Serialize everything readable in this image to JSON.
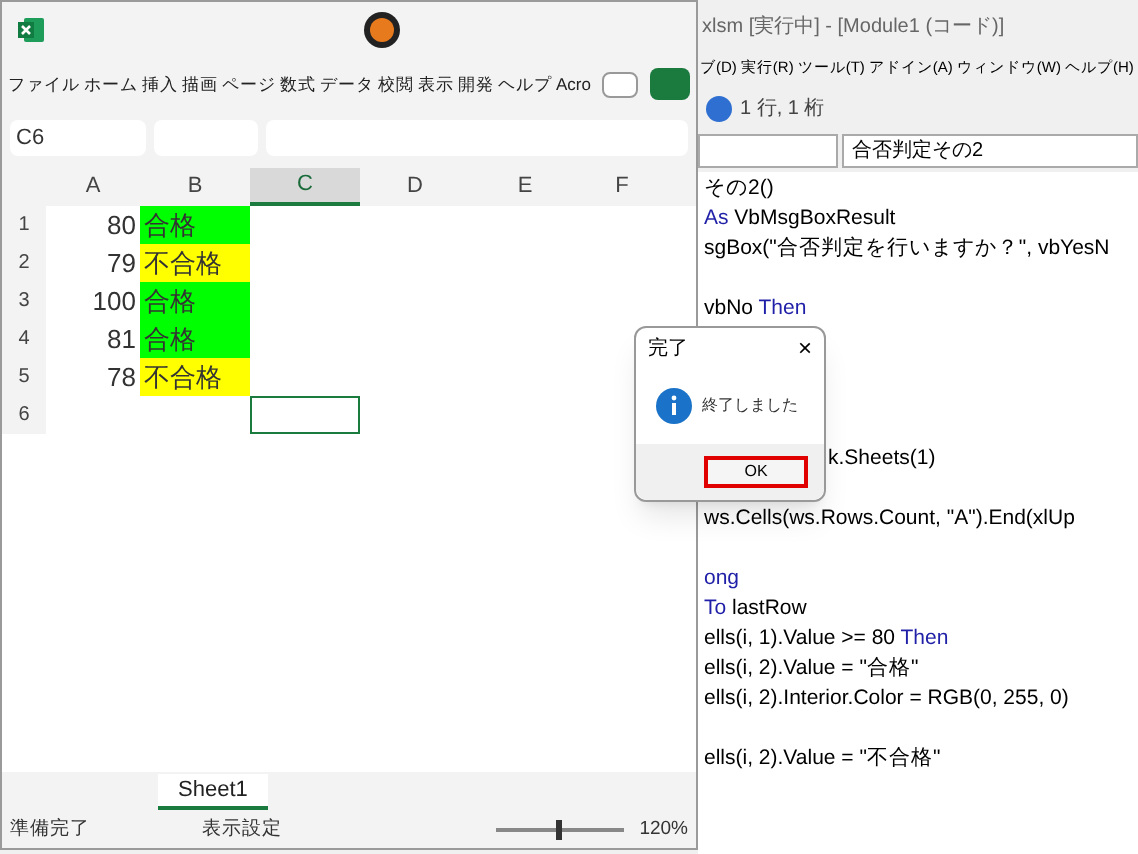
{
  "excel": {
    "ribbon_tabs": [
      {
        "label": "ファイル"
      },
      {
        "label": "ホーム"
      },
      {
        "label": "挿入"
      },
      {
        "label": "描画"
      },
      {
        "label": "ページ"
      },
      {
        "label": "数式"
      },
      {
        "label": "データ"
      },
      {
        "label": "校閲"
      },
      {
        "label": "表示"
      },
      {
        "label": "開発"
      },
      {
        "label": "ヘルプ"
      },
      {
        "label": "Acro"
      }
    ],
    "name_box": "C6",
    "columns": [
      "A",
      "B",
      "C",
      "D",
      "E",
      "F"
    ],
    "rows": [
      {
        "number": "1",
        "a": "80",
        "b": "合格",
        "color": "#00ff00"
      },
      {
        "number": "2",
        "a": "79",
        "b": "不合格",
        "color": "#ffff00"
      },
      {
        "number": "3",
        "a": "100",
        "b": "合格",
        "color": "#00ff00"
      },
      {
        "number": "4",
        "a": "81",
        "b": "合格",
        "color": "#00ff00"
      },
      {
        "number": "5",
        "a": "78",
        "b": "不合格",
        "color": "#ffff00"
      },
      {
        "number": "6"
      }
    ],
    "sheet_tabs": [
      {
        "label": "Sheet1",
        "selected": true
      }
    ],
    "status_bar": {
      "ready": "準備完了",
      "display_settings": "表示設定",
      "zoom": "120%",
      "zoom_slider": {
        "level": 0.5
      }
    }
  },
  "vbe": {
    "title": "xlsm [実行中] - [Module1 (コード)]",
    "menu": [
      "ブ(D)",
      "実行(R)",
      "ツール(T)",
      "アドイン(A)",
      "ウィンドウ(W)",
      "ヘルプ(H)"
    ],
    "position": "1 行, 1 桁",
    "procedure": "合否判定その2",
    "code_lines": [
      {
        "kind": "code",
        "segments": [
          {
            "text": "その2()",
            "keyword": false
          }
        ]
      },
      {
        "kind": "code",
        "segments": [
          {
            "text": "As",
            "keyword": true
          },
          {
            "text": " VbMsgBoxResult",
            "keyword": false
          }
        ]
      },
      {
        "kind": "code",
        "segments": [
          {
            "text": "sgBox(\"合否判定を行いますか？\", vbYesN",
            "keyword": false
          }
        ]
      },
      {
        "kind": "empty"
      },
      {
        "kind": "code",
        "segments": [
          {
            "text": "vbNo ",
            "keyword": false
          },
          {
            "text": "Then",
            "keyword": true
          }
        ]
      },
      {
        "kind": "empty"
      },
      {
        "kind": "empty"
      },
      {
        "kind": "empty"
      },
      {
        "kind": "empty"
      },
      {
        "kind": "beside_dialog",
        "segments": [
          {
            "text": "k.Sheets(1)",
            "keyword": false
          }
        ]
      },
      {
        "kind": "empty"
      },
      {
        "kind": "code",
        "segments": [
          {
            "text": "ws.Cells(ws.Rows.Count, \"A\").End(xlUp",
            "keyword": false
          }
        ]
      },
      {
        "kind": "empty"
      },
      {
        "kind": "code",
        "segments": [
          {
            "text": "ong",
            "keyword": true
          }
        ]
      },
      {
        "kind": "code",
        "segments": [
          {
            "text": "To",
            "keyword": true
          },
          {
            "text": " lastRow",
            "keyword": false
          }
        ]
      },
      {
        "kind": "code",
        "segments": [
          {
            "text": "ells(i, 1).Value >= 80 ",
            "keyword": false
          },
          {
            "text": "Then",
            "keyword": true
          }
        ]
      },
      {
        "kind": "code",
        "segments": [
          {
            "text": "ells(i, 2).Value = \"合格\"",
            "keyword": false
          }
        ]
      },
      {
        "kind": "code",
        "segments": [
          {
            "text": "ells(i, 2).Interior.Color = RGB(0, 255, 0)",
            "keyword": false
          }
        ]
      },
      {
        "kind": "empty"
      },
      {
        "kind": "code",
        "segments": [
          {
            "text": "ells(i, 2).Value = \"不合格\"",
            "keyword": false
          }
        ]
      }
    ]
  },
  "dialog": {
    "title": "完了",
    "close": "×",
    "message": "終了しました",
    "button": "OK"
  }
}
